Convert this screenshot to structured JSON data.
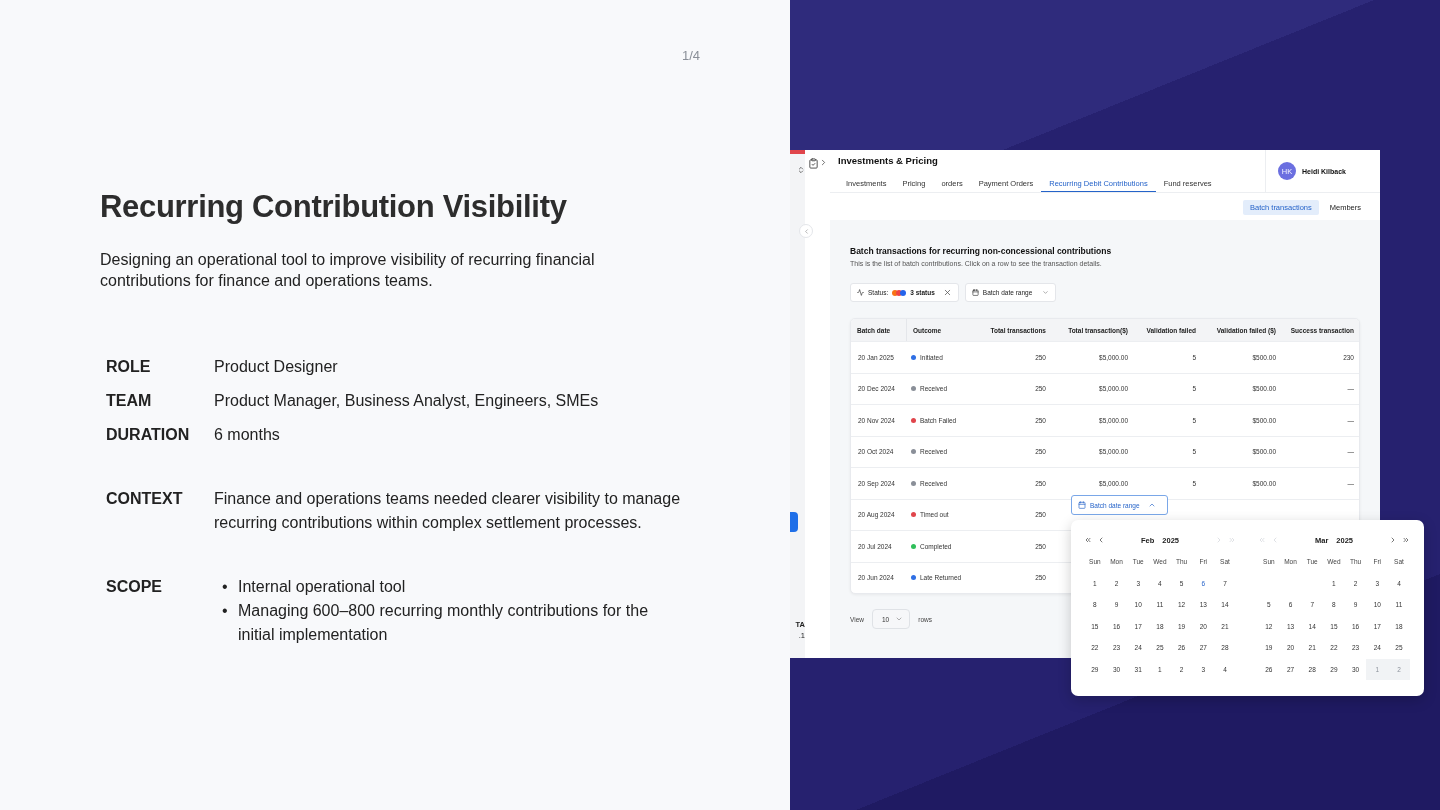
{
  "page_counter": "1/4",
  "title": "Recurring Contribution Visibility",
  "description": "Designing an operational tool to improve visibility of recurring financial contributions for finance and operations teams.",
  "detail_groups": [
    [
      {
        "label": "ROLE",
        "value": "Product Designer"
      },
      {
        "label": "TEAM",
        "value": "Product Manager, Business Analyst, Engineers, SMEs"
      },
      {
        "label": "DURATION",
        "value": "6 months"
      }
    ],
    [
      {
        "label": "CONTEXT",
        "value": "Finance and operations teams needed clearer visibility to manage recurring contributions within complex settlement processes."
      }
    ],
    [
      {
        "label": "SCOPE",
        "bullets": [
          {
            "marker": "•",
            "text": "Internal operational tool"
          },
          {
            "marker": "•",
            "text": "Managing 600–800 recurring monthly contributions for the initial implementation"
          }
        ]
      }
    ]
  ],
  "app": {
    "sidebar_texts": [
      "TA",
      ".1"
    ],
    "header": {
      "title": "Investments & Pricing",
      "user": {
        "initials": "HK",
        "name": "Heidi Kilback"
      },
      "tabs": [
        {
          "label": "Investments",
          "selected": false
        },
        {
          "label": "Pricing",
          "selected": false
        },
        {
          "label": "orders",
          "selected": false
        },
        {
          "label": "Payment Orders",
          "selected": false
        },
        {
          "label": "Recurring Debit Contributions",
          "selected": true
        },
        {
          "label": "Fund reserves",
          "selected": false
        }
      ]
    },
    "subtabs": [
      {
        "label": "Batch transactions",
        "selected": true
      },
      {
        "label": "Members",
        "selected": false
      }
    ],
    "section": {
      "title": "Batch transactions for recurring non-concessional contributions",
      "subtitle": "This is the list of batch contributions. Click on a row to see the transaction details."
    },
    "filters": {
      "status_label": "Status:",
      "status_value": "3 status",
      "status_dots": [
        {
          "color": "#f97316"
        },
        {
          "color": "#ef4444"
        },
        {
          "color": "#2563eb"
        }
      ],
      "date_label": "Batch date range"
    },
    "table": {
      "columns": [
        "Batch date",
        "Outcome",
        "Total transactions",
        "Total transaction($)",
        "Validation failed",
        "Validation failed ($)",
        "Success transaction"
      ],
      "rows": [
        {
          "color": "#2f6fe4",
          "cells": [
            "20 Jan 2025",
            "Initiated",
            "250",
            "$5,000.00",
            "5",
            "$500.00",
            "230"
          ]
        },
        {
          "color": "#8a8f98",
          "cells": [
            "20 Dec 2024",
            "Received",
            "250",
            "$5,000.00",
            "5",
            "$500.00",
            "—"
          ]
        },
        {
          "color": "#e0454b",
          "cells": [
            "20 Nov 2024",
            "Batch Failed",
            "250",
            "$5,000.00",
            "5",
            "$500.00",
            "—"
          ]
        },
        {
          "color": "#8a8f98",
          "cells": [
            "20 Oct 2024",
            "Received",
            "250",
            "$5,000.00",
            "5",
            "$500.00",
            "—"
          ]
        },
        {
          "color": "#8a8f98",
          "cells": [
            "20 Sep 2024",
            "Received",
            "250",
            "$5,000.00",
            "5",
            "$500.00",
            "—"
          ]
        },
        {
          "color": "#e0454b",
          "cells": [
            "20 Aug 2024",
            "Timed out",
            "250"
          ]
        },
        {
          "color": "#2fbf5a",
          "cells": [
            "20 Jul 2024",
            "Completed",
            "250"
          ]
        },
        {
          "color": "#2f6fe4",
          "cells": [
            "20 Jun 2024",
            "Late Returned",
            "250"
          ]
        }
      ]
    },
    "pagination": {
      "label": "View",
      "value": "10",
      "suffix": "rows"
    },
    "date_picker": {
      "button_label": "Batch date range",
      "expanded": true,
      "months": [
        {
          "month": "Feb",
          "year": "2025",
          "back_enabled": true,
          "forward_enabled": false,
          "weekdays": [
            "Sun",
            "Mon",
            "Tue",
            "Wed",
            "Thu",
            "Fri",
            "Sat"
          ],
          "weeks": [
            [
              {
                "label": "1",
                "kind": "day"
              },
              {
                "label": "2",
                "kind": "day"
              },
              {
                "label": "3",
                "kind": "day"
              },
              {
                "label": "4",
                "kind": "day"
              },
              {
                "label": "5",
                "kind": "day"
              },
              {
                "label": "6",
                "kind": "today"
              },
              {
                "label": "7",
                "kind": "day"
              }
            ],
            [
              {
                "label": "8",
                "kind": "day"
              },
              {
                "label": "9",
                "kind": "day"
              },
              {
                "label": "10",
                "kind": "day"
              },
              {
                "label": "11",
                "kind": "day"
              },
              {
                "label": "12",
                "kind": "day"
              },
              {
                "label": "13",
                "kind": "day"
              },
              {
                "label": "14",
                "kind": "day"
              }
            ],
            [
              {
                "label": "15",
                "kind": "day"
              },
              {
                "label": "16",
                "kind": "day"
              },
              {
                "label": "17",
                "kind": "day"
              },
              {
                "label": "18",
                "kind": "day"
              },
              {
                "label": "19",
                "kind": "day"
              },
              {
                "label": "20",
                "kind": "day"
              },
              {
                "label": "21",
                "kind": "day"
              }
            ],
            [
              {
                "label": "22",
                "kind": "day"
              },
              {
                "label": "23",
                "kind": "day"
              },
              {
                "label": "24",
                "kind": "day"
              },
              {
                "label": "25",
                "kind": "day"
              },
              {
                "label": "26",
                "kind": "day"
              },
              {
                "label": "27",
                "kind": "day"
              },
              {
                "label": "28",
                "kind": "day"
              }
            ],
            [
              {
                "label": "29",
                "kind": "day"
              },
              {
                "label": "30",
                "kind": "day"
              },
              {
                "label": "31",
                "kind": "day"
              },
              {
                "label": "1",
                "kind": "day"
              },
              {
                "label": "2",
                "kind": "day"
              },
              {
                "label": "3",
                "kind": "day"
              },
              {
                "label": "4",
                "kind": "day"
              }
            ]
          ]
        },
        {
          "month": "Mar",
          "year": "2025",
          "back_enabled": false,
          "forward_enabled": true,
          "weekdays": [
            "Sun",
            "Mon",
            "Tue",
            "Wed",
            "Thu",
            "Fri",
            "Sat"
          ],
          "weeks": [
            [
              {
                "label": "1",
                "kind": "day"
              },
              {
                "label": "2",
                "kind": "day"
              },
              {
                "label": "3",
                "kind": "day"
              },
              {
                "label": "4",
                "kind": "day"
              }
            ],
            [
              {
                "label": "5",
                "kind": "day"
              },
              {
                "label": "6",
                "kind": "day"
              },
              {
                "label": "7",
                "kind": "day"
              },
              {
                "label": "8",
                "kind": "day"
              },
              {
                "label": "9",
                "kind": "day"
              },
              {
                "label": "10",
                "kind": "day"
              },
              {
                "label": "11",
                "kind": "day"
              }
            ],
            [
              {
                "label": "12",
                "kind": "day"
              },
              {
                "label": "13",
                "kind": "day"
              },
              {
                "label": "14",
                "kind": "day"
              },
              {
                "label": "15",
                "kind": "day"
              },
              {
                "label": "16",
                "kind": "day"
              },
              {
                "label": "17",
                "kind": "day"
              },
              {
                "label": "18",
                "kind": "day"
              }
            ],
            [
              {
                "label": "19",
                "kind": "day"
              },
              {
                "label": "20",
                "kind": "day"
              },
              {
                "label": "21",
                "kind": "day"
              },
              {
                "label": "22",
                "kind": "day"
              },
              {
                "label": "23",
                "kind": "day"
              },
              {
                "label": "24",
                "kind": "day"
              },
              {
                "label": "25",
                "kind": "day"
              }
            ],
            [
              {
                "label": "26",
                "kind": "day"
              },
              {
                "label": "27",
                "kind": "day"
              },
              {
                "label": "28",
                "kind": "day"
              },
              {
                "label": "29",
                "kind": "day"
              },
              {
                "label": "30",
                "kind": "day"
              },
              {
                "label": "1",
                "kind": "outside"
              },
              {
                "label": "2",
                "kind": "outside"
              }
            ]
          ]
        }
      ]
    }
  }
}
